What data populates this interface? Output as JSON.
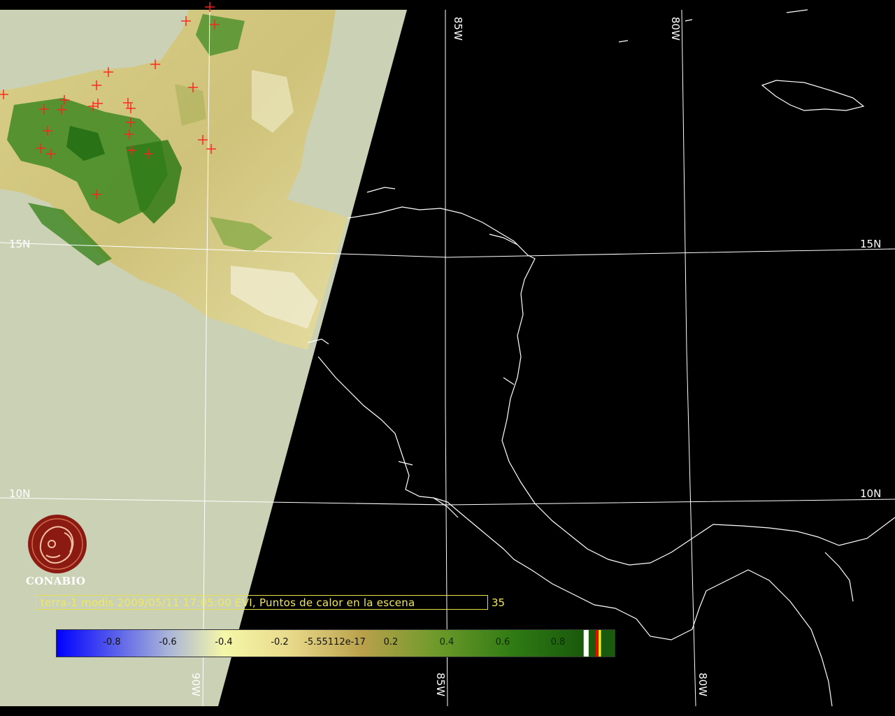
{
  "map": {
    "grid_labels": {
      "lat_15n_left": "15N",
      "lat_15n_right": "15N",
      "lat_10n_left": "10N",
      "lat_10n_right": "10N",
      "lon_85w_top": "85W",
      "lon_80w_top": "80W",
      "lon_90w_bottom": "90W",
      "lon_85w_bottom": "85W",
      "lon_80w_bottom": "80W"
    },
    "colors": {
      "ocean": "#000000",
      "swath_background": "#cbd1b4",
      "coastline": "#ffffff",
      "gridline": "#ffffff",
      "hotspot_marker": "#ff2020",
      "caption": "#f0e860"
    },
    "hotspot_marker_icon": "red-cross-icon"
  },
  "logo": {
    "icon": "conabio-logo-icon",
    "text": "CONABIO",
    "color": "#8b1a12"
  },
  "caption": {
    "text": "terra-1 modis 2009/05/11 17:05:00 EVI, Puntos de calor en la escena",
    "hotspot_count": "35"
  },
  "colorbar": {
    "ticks": [
      "-0.8",
      "-0.6",
      "-0.4",
      "-0.2",
      "-5.55112e-17",
      "0.2",
      "0.4",
      "0.6",
      "0.8"
    ],
    "gradient_colors": [
      "#0000ff",
      "#a9b4d8",
      "#f5f7a8",
      "#e8d98a",
      "#b8a04a",
      "#6e9a2a",
      "#2f7a14",
      "#1a5a0c"
    ],
    "end_marks": [
      "#ffffff",
      "#ff0000",
      "#ffff00"
    ]
  }
}
